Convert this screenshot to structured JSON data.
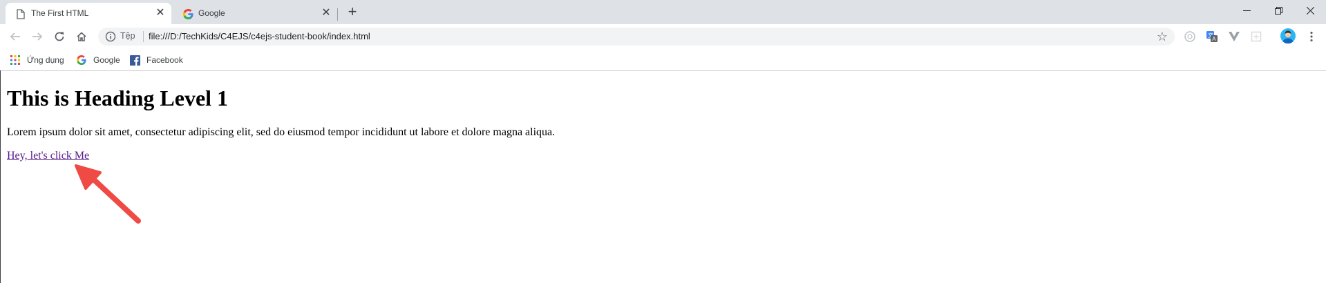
{
  "tabs": [
    {
      "title": "The First HTML",
      "icon": "document-icon",
      "active": true
    },
    {
      "title": "Google",
      "icon": "google-icon",
      "active": false
    }
  ],
  "toolbar": {
    "site_chip": "Tệp",
    "url": "file:///D:/TechKids/C4EJS/c4ejs-student-book/index.html"
  },
  "bookmarks": [
    {
      "label": "Ứng dụng",
      "icon": "apps-grid-icon"
    },
    {
      "label": "Google",
      "icon": "google-icon"
    },
    {
      "label": "Facebook",
      "icon": "facebook-icon"
    }
  ],
  "page": {
    "heading": "This is Heading Level 1",
    "paragraph": "Lorem ipsum dolor sit amet, consectetur adipiscing elit, sed do eiusmod tempor incididunt ut labore et dolore magna aliqua.",
    "link": "Hey, let's click Me"
  },
  "colors": {
    "tabstrip_bg": "#dee1e6",
    "omnibox_bg": "#f1f3f4",
    "visited_link": "#551a8b",
    "annotation_arrow": "#f04a45"
  }
}
